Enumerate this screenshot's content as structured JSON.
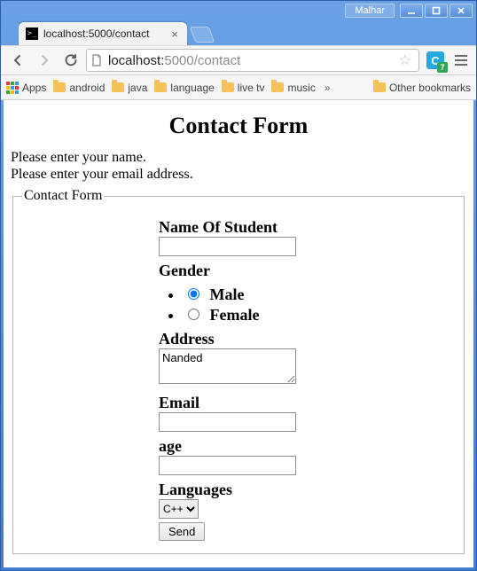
{
  "window": {
    "user_label": "Malhar"
  },
  "tab": {
    "title": "localhost:5000/contact"
  },
  "address": {
    "host": "localhost:",
    "port_and_path": "5000/contact"
  },
  "bookmarks": {
    "apps_label": "Apps",
    "items": [
      "android",
      "java",
      "language",
      "live tv",
      "music"
    ],
    "overflow": "»",
    "other": "Other bookmarks"
  },
  "extension": {
    "letter": "C",
    "badge": "7"
  },
  "page": {
    "title": "Contact Form",
    "messages": [
      "Please enter your name.",
      "Please enter your email address."
    ],
    "legend": "Contact Form",
    "labels": {
      "name": "Name Of Student",
      "gender": "Gender",
      "address": "Address",
      "email": "Email",
      "age": "age",
      "languages": "Languages"
    },
    "gender_options": {
      "male": "Male",
      "female": "Female"
    },
    "gender_selected": "male",
    "address_value": "Nanded",
    "name_value": "",
    "email_value": "",
    "age_value": "",
    "languages_options": [
      "C++"
    ],
    "languages_selected": "C++",
    "submit_label": "Send"
  }
}
